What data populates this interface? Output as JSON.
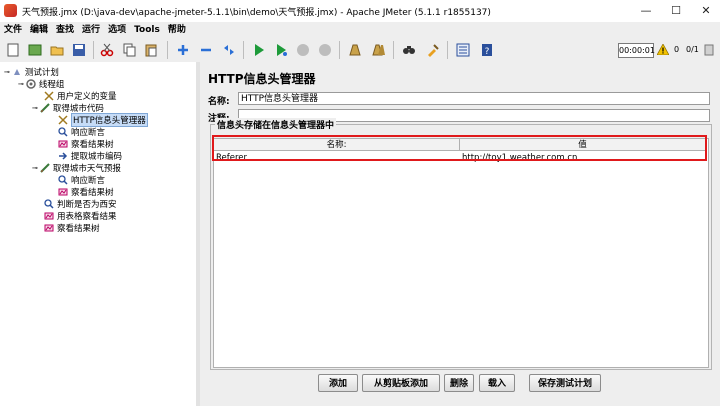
{
  "window": {
    "title": "天气预报.jmx (D:\\java-dev\\apache-jmeter-5.1.1\\bin\\demo\\天气预报.jmx) - Apache JMeter (5.1.1 r1855137)",
    "minimize": "—",
    "maximize": "☐",
    "close": "✕"
  },
  "menu": [
    "文件",
    "编辑",
    "查找",
    "运行",
    "选项",
    "Tools",
    "帮助"
  ],
  "toolbar": {
    "timer": "00:00:01",
    "warnings": "0",
    "threads": "0/1"
  },
  "tree": [
    {
      "label": "测试计划",
      "icon": "test-plan-icon"
    },
    {
      "label": "线程组",
      "icon": "thread-group-icon"
    },
    {
      "label": "用户定义的变量",
      "icon": "config-element-icon"
    },
    {
      "label": "取得城市代码",
      "icon": "sampler-icon"
    },
    {
      "label": "HTTP信息头管理器",
      "icon": "config-element-icon"
    },
    {
      "label": "响应断言",
      "icon": "assertion-icon"
    },
    {
      "label": "察看结果树",
      "icon": "listener-icon"
    },
    {
      "label": "提取城市编码",
      "icon": "post-processor-icon"
    },
    {
      "label": "取得城市天气预报",
      "icon": "sampler-icon"
    },
    {
      "label": "响应断言",
      "icon": "assertion-icon"
    },
    {
      "label": "察看结果树",
      "icon": "listener-icon"
    },
    {
      "label": "判断是否为西安",
      "icon": "assertion-icon"
    },
    {
      "label": "用表格察看结果",
      "icon": "listener-icon"
    },
    {
      "label": "察看结果树",
      "icon": "listener-icon"
    }
  ],
  "panel": {
    "title": "HTTP信息头管理器",
    "name_label": "名称:",
    "name_value": "HTTP信息头管理器",
    "comment_label": "注释:",
    "comment_value": "",
    "group_title": "信息头存储在信息头管理器中",
    "columns": [
      "名称:",
      "值"
    ],
    "rows": [
      {
        "name": "Referer",
        "value": "http://toy1.weather.com.cn"
      }
    ]
  },
  "buttons": [
    "添加",
    "从剪贴板添加",
    "删除",
    "载入",
    "保存测试计划"
  ]
}
